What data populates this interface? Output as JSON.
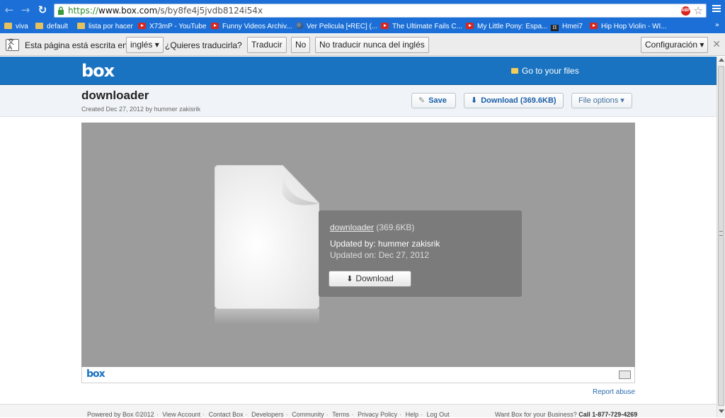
{
  "browser": {
    "url_scheme": "https://",
    "url_host": "www.box.com",
    "url_path": "/s/by8fe4j5jvdb8124i54x",
    "abp_label": "ABP",
    "bookmarks": [
      {
        "label": "viva",
        "icon": "folder-icon"
      },
      {
        "label": "default",
        "icon": "folder-icon"
      },
      {
        "label": "lista por hacer",
        "icon": "folder-icon"
      },
      {
        "label": "X73mP - YouTube",
        "icon": "youtube-icon"
      },
      {
        "label": "Funny Videos Archiv...",
        "icon": "youtube-icon"
      },
      {
        "label": "Ver Pelicula [•REC] (...",
        "icon": "globe-icon"
      },
      {
        "label": "The Ultimate Fails C...",
        "icon": "youtube-icon"
      },
      {
        "label": "My Little Pony: Espa...",
        "icon": "youtube-icon"
      },
      {
        "label": "Hmei7",
        "icon": "pi-icon"
      },
      {
        "label": "Hip Hop Violin - WI...",
        "icon": "youtube-icon"
      }
    ],
    "bookmarks_more": "»"
  },
  "translate_bar": {
    "icon_text": "文A",
    "prefix": "Esta página está escrita en",
    "language": "inglés ▾",
    "question": "¿Quieres traducirla?",
    "translate_label": "Traducir",
    "no_label": "No",
    "never_label": "No traducir nunca del inglés",
    "settings_label": "Configuración ▾",
    "close": "✕"
  },
  "box_header": {
    "logo": "box",
    "goto_files": "Go to your files"
  },
  "file": {
    "title": "downloader",
    "created": "Created Dec 27, 2012 by hummer zakisrik",
    "save_label": "Save",
    "download_label": "Download  (369.6KB)",
    "file_options_label": "File options ▾"
  },
  "preview": {
    "name_link": "downloader",
    "size": "(369.6KB)",
    "updated_by": "Updated by: hummer zakisrik",
    "updated_on": "Updated on: Dec 27, 2012",
    "download_label": "Download",
    "footer_logo": "box"
  },
  "report_abuse": "Report abuse",
  "footer": {
    "links": [
      "Powered by Box ©2012",
      "View Account",
      "Contact Box",
      "Developers",
      "Community",
      "Terms",
      "Privacy Policy",
      "Help",
      "Log Out"
    ],
    "business_text": "Want Box for your Business? ",
    "business_phone": "Call 1-877-729-4269"
  },
  "colors": {
    "chrome_blue": "#1b6fd6",
    "box_blue": "#1a73c0",
    "preview_gray": "#9c9c9c"
  }
}
